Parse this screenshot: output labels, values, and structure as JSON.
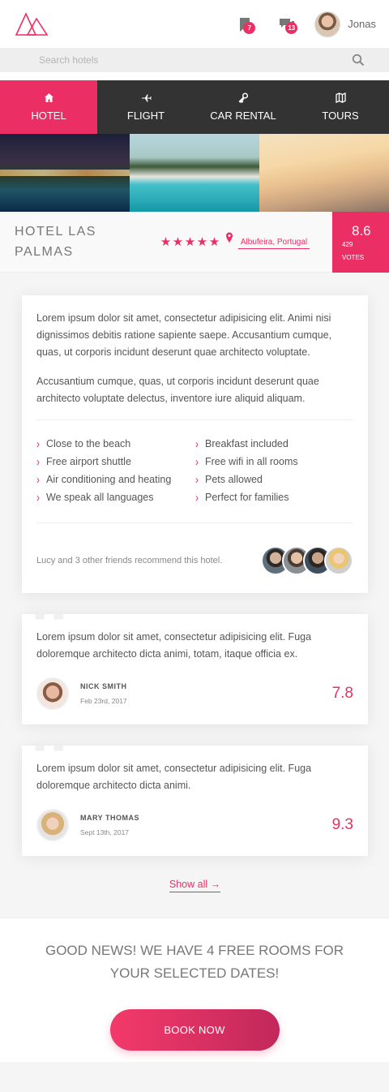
{
  "header": {
    "logo_icon": "triangles-logo",
    "bookmarks_count": "7",
    "messages_count": "13",
    "user_name": "Jonas"
  },
  "search": {
    "placeholder": "Search hotels"
  },
  "tabs": [
    {
      "label": "Hotel",
      "icon": "home-icon",
      "active": true
    },
    {
      "label": "Flight",
      "icon": "plane-icon",
      "active": false
    },
    {
      "label": "Car rental",
      "icon": "key-icon",
      "active": false
    },
    {
      "label": "Tours",
      "icon": "map-icon",
      "active": false
    }
  ],
  "hotel": {
    "name": "Hotel Las Palmas",
    "stars": 5,
    "location": "Albufeira, Portugal",
    "rating": "8.6",
    "votes_count": "429",
    "votes_label": "votes"
  },
  "description": {
    "p1": "Lorem ipsum dolor sit amet, consectetur adipisicing elit. Animi nisi dignissimos debitis ratione sapiente saepe. Accusantium cumque, quas, ut corporis incidunt deserunt quae architecto voluptate.",
    "p2": "Accusantium cumque, quas, ut corporis incidunt deserunt quae architecto voluptate delectus, inventore iure aliquid aliquam."
  },
  "features": [
    "Close to the beach",
    "Breakfast included",
    "Free airport shuttle",
    "Free wifi in all rooms",
    "Air conditioning and heating",
    "Pets allowed",
    "We speak all languages",
    "Perfect for families"
  ],
  "recommend": {
    "text": "Lucy and 3 other friends recommend this hotel."
  },
  "reviews": [
    {
      "text": "Lorem ipsum dolor sit amet, consectetur adipisicing elit. Fuga doloremque architecto dicta animi, totam, itaque officia ex.",
      "name": "Nick Smith",
      "date": "Feb 23rd, 2017",
      "score": "7.8"
    },
    {
      "text": "Lorem ipsum dolor sit amet, consectetur adipisicing elit. Fuga doloremque architecto dicta animi.",
      "name": "Mary Thomas",
      "date": "Sept 13th, 2017",
      "score": "9.3"
    }
  ],
  "show_all": "Show all →",
  "cta": {
    "text": "Good news! We have 4 free rooms for your selected dates!",
    "button": "Book now"
  },
  "colors": {
    "primary": "#eb2f64",
    "dark": "#333333"
  }
}
